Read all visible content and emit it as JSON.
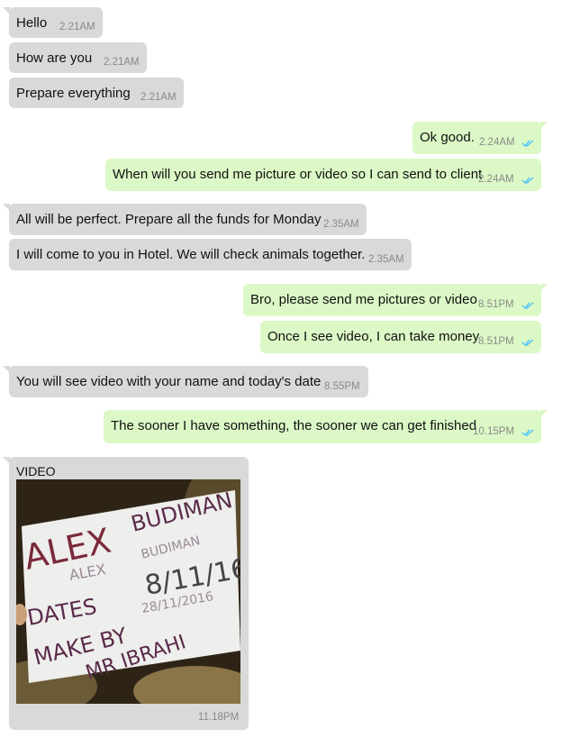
{
  "messages": [
    {
      "text": "Hello",
      "time": "2.21AM"
    },
    {
      "text": "How are you",
      "time": "2.21AM"
    },
    {
      "text": "Prepare everything",
      "time": "2.21AM"
    },
    {
      "text": "Ok good.",
      "time": "2.24AM"
    },
    {
      "text": "When will you send me picture or video so I can send to client",
      "time": "2.24AM"
    },
    {
      "text": "All will be perfect. Prepare all the funds for Monday",
      "time": "2.35AM"
    },
    {
      "text": "I will come to you in Hotel. We will check animals together.",
      "time": "2.35AM"
    },
    {
      "text": "Bro, please send me pictures or video",
      "time": "8.51PM"
    },
    {
      "text": "Once I see video, I can take money",
      "time": "8.51PM"
    },
    {
      "text": "You will see video with your name and today's date",
      "time": "8.55PM"
    },
    {
      "text": "The sooner I have something, the sooner we can get finished",
      "time": "10.15PM"
    }
  ],
  "video_message": {
    "label": "VIDEO",
    "time": "11.18PM",
    "handwriting": [
      "ALEX",
      "BUDIMAN",
      "ALEX",
      "BUDIMAN",
      "8/11/16",
      "DATES",
      "28/11/2016",
      "MAKE BY",
      "MR IBRAHI"
    ]
  },
  "colors": {
    "incoming_bubble": "#d9d9d9",
    "outgoing_bubble": "#dcf8c6",
    "read_ticks": "#4fc3f7",
    "timestamp": "#8a8a8a"
  },
  "icons": {
    "read_receipt": "double-check-icon"
  }
}
